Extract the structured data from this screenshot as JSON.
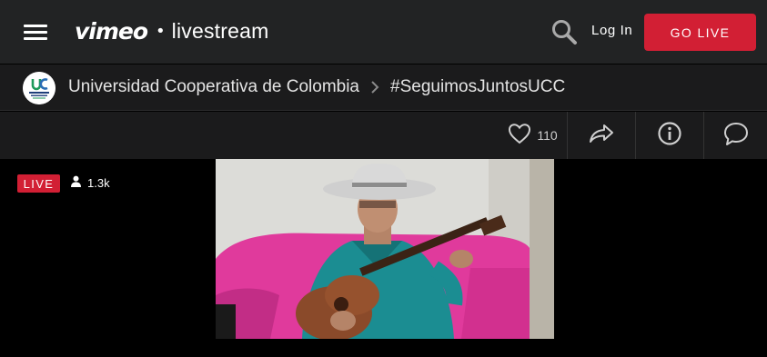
{
  "header": {
    "logo_brand": "vimeo",
    "logo_dot": "•",
    "logo_product": "livestream",
    "login_label": "Log In",
    "go_live_label": "GO LIVE",
    "accent_color": "#d21f34"
  },
  "channel": {
    "name": "Universidad Cooperativa de Colombia",
    "event": "#SeguimosJuntosUCC",
    "avatar_icon": "ucc-logo",
    "avatar_text": "COOPERATIVA"
  },
  "actions": {
    "like_count": "110",
    "icons": [
      "heart-icon",
      "share-icon",
      "info-icon",
      "comment-icon"
    ]
  },
  "player": {
    "live_label": "LIVE",
    "viewer_count": "1.3k"
  }
}
